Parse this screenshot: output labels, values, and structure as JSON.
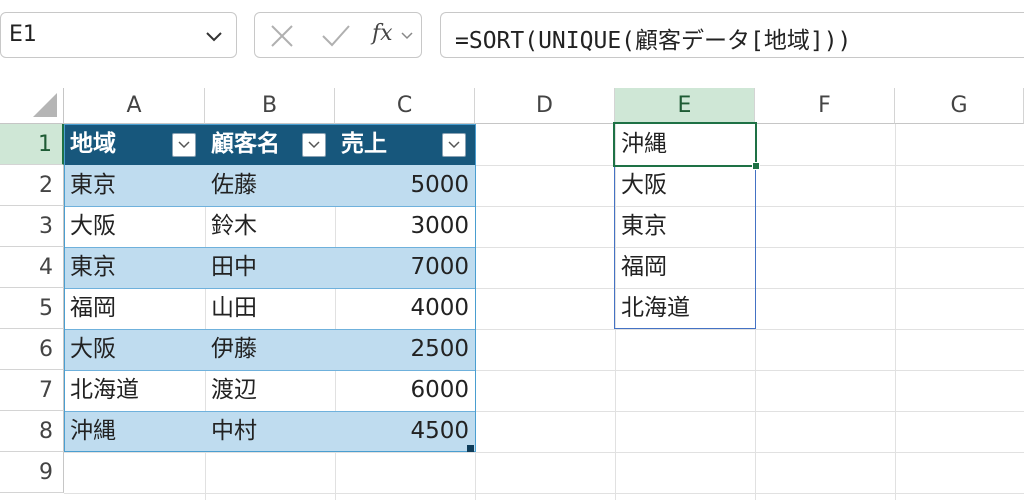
{
  "name_box": {
    "value": "E1"
  },
  "formula_bar": {
    "cancel_icon": "cancel-icon",
    "enter_icon": "enter-icon",
    "fx_label": "fx",
    "formula": "=SORT(UNIQUE(顧客データ[地域]))"
  },
  "columns": [
    "A",
    "B",
    "C",
    "D",
    "E",
    "F",
    "G"
  ],
  "rows": [
    "1",
    "2",
    "3",
    "4",
    "5",
    "6",
    "7",
    "8",
    "9"
  ],
  "active_column": "E",
  "active_row": "1",
  "table": {
    "headers": [
      "地域",
      "顧客名",
      "売上"
    ],
    "rows": [
      [
        "東京",
        "佐藤",
        "5000"
      ],
      [
        "大阪",
        "鈴木",
        "3000"
      ],
      [
        "東京",
        "田中",
        "7000"
      ],
      [
        "福岡",
        "山田",
        "4000"
      ],
      [
        "大阪",
        "伊藤",
        "2500"
      ],
      [
        "北海道",
        "渡辺",
        "6000"
      ],
      [
        "沖縄",
        "中村",
        "4500"
      ]
    ],
    "header_color": "#17577c",
    "band_color": "#bfdcef"
  },
  "spill": {
    "values": [
      "沖縄",
      "大阪",
      "東京",
      "福岡",
      "北海道"
    ],
    "border_color": "#4472c4"
  },
  "selection_color": "#1e7145"
}
